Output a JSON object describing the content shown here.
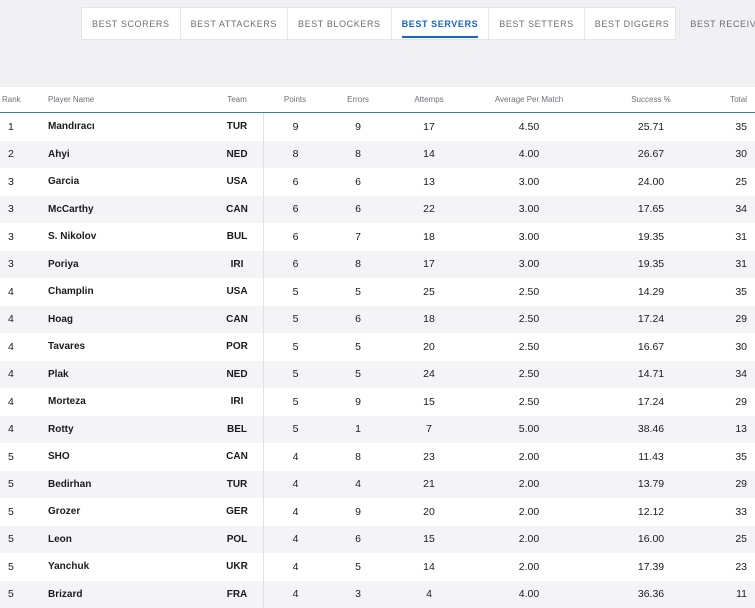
{
  "tabs": [
    {
      "label": "BEST SCORERS",
      "active": false
    },
    {
      "label": "BEST ATTACKERS",
      "active": false
    },
    {
      "label": "BEST BLOCKERS",
      "active": false
    },
    {
      "label": "BEST SERVERS",
      "active": true
    },
    {
      "label": "BEST SETTERS",
      "active": false
    },
    {
      "label": "BEST DIGGERS",
      "active": false
    },
    {
      "label": "BEST RECEIVERS",
      "active": false
    }
  ],
  "table": {
    "headers": {
      "rank": "Rank",
      "name": "Player Name",
      "team": "Team",
      "points": "Points",
      "errors": "Errors",
      "attempts": "Attemps",
      "avg": "Average Per Match",
      "success": "Success %",
      "total": "Total"
    },
    "rows": [
      {
        "rank": "1",
        "name": "Mandıracı",
        "team": "TUR",
        "points": "9",
        "errors": "9",
        "attempts": "17",
        "avg": "4.50",
        "success": "25.71",
        "total": "35"
      },
      {
        "rank": "2",
        "name": "Ahyi",
        "team": "NED",
        "points": "8",
        "errors": "8",
        "attempts": "14",
        "avg": "4.00",
        "success": "26.67",
        "total": "30"
      },
      {
        "rank": "3",
        "name": "Garcia",
        "team": "USA",
        "points": "6",
        "errors": "6",
        "attempts": "13",
        "avg": "3.00",
        "success": "24.00",
        "total": "25"
      },
      {
        "rank": "3",
        "name": "McCarthy",
        "team": "CAN",
        "points": "6",
        "errors": "6",
        "attempts": "22",
        "avg": "3.00",
        "success": "17.65",
        "total": "34"
      },
      {
        "rank": "3",
        "name": "S. Nikolov",
        "team": "BUL",
        "points": "6",
        "errors": "7",
        "attempts": "18",
        "avg": "3.00",
        "success": "19.35",
        "total": "31"
      },
      {
        "rank": "3",
        "name": "Poriya",
        "team": "IRI",
        "points": "6",
        "errors": "8",
        "attempts": "17",
        "avg": "3.00",
        "success": "19.35",
        "total": "31"
      },
      {
        "rank": "4",
        "name": "Champlin",
        "team": "USA",
        "points": "5",
        "errors": "5",
        "attempts": "25",
        "avg": "2.50",
        "success": "14.29",
        "total": "35"
      },
      {
        "rank": "4",
        "name": "Hoag",
        "team": "CAN",
        "points": "5",
        "errors": "6",
        "attempts": "18",
        "avg": "2.50",
        "success": "17.24",
        "total": "29"
      },
      {
        "rank": "4",
        "name": "Tavares",
        "team": "POR",
        "points": "5",
        "errors": "5",
        "attempts": "20",
        "avg": "2.50",
        "success": "16.67",
        "total": "30"
      },
      {
        "rank": "4",
        "name": "Plak",
        "team": "NED",
        "points": "5",
        "errors": "5",
        "attempts": "24",
        "avg": "2.50",
        "success": "14.71",
        "total": "34"
      },
      {
        "rank": "4",
        "name": "Morteza",
        "team": "IRI",
        "points": "5",
        "errors": "9",
        "attempts": "15",
        "avg": "2.50",
        "success": "17.24",
        "total": "29"
      },
      {
        "rank": "4",
        "name": "Rotty",
        "team": "BEL",
        "points": "5",
        "errors": "1",
        "attempts": "7",
        "avg": "5.00",
        "success": "38.46",
        "total": "13"
      },
      {
        "rank": "5",
        "name": "SHO",
        "team": "CAN",
        "points": "4",
        "errors": "8",
        "attempts": "23",
        "avg": "2.00",
        "success": "11.43",
        "total": "35"
      },
      {
        "rank": "5",
        "name": "Bedirhan",
        "team": "TUR",
        "points": "4",
        "errors": "4",
        "attempts": "21",
        "avg": "2.00",
        "success": "13.79",
        "total": "29"
      },
      {
        "rank": "5",
        "name": "Grozer",
        "team": "GER",
        "points": "4",
        "errors": "9",
        "attempts": "20",
        "avg": "2.00",
        "success": "12.12",
        "total": "33"
      },
      {
        "rank": "5",
        "name": "Leon",
        "team": "POL",
        "points": "4",
        "errors": "6",
        "attempts": "15",
        "avg": "2.00",
        "success": "16.00",
        "total": "25"
      },
      {
        "rank": "5",
        "name": "Yanchuk",
        "team": "UKR",
        "points": "4",
        "errors": "5",
        "attempts": "14",
        "avg": "2.00",
        "success": "17.39",
        "total": "23"
      },
      {
        "rank": "5",
        "name": "Brizard",
        "team": "FRA",
        "points": "4",
        "errors": "3",
        "attempts": "4",
        "avg": "4.00",
        "success": "36.36",
        "total": "11"
      }
    ]
  }
}
